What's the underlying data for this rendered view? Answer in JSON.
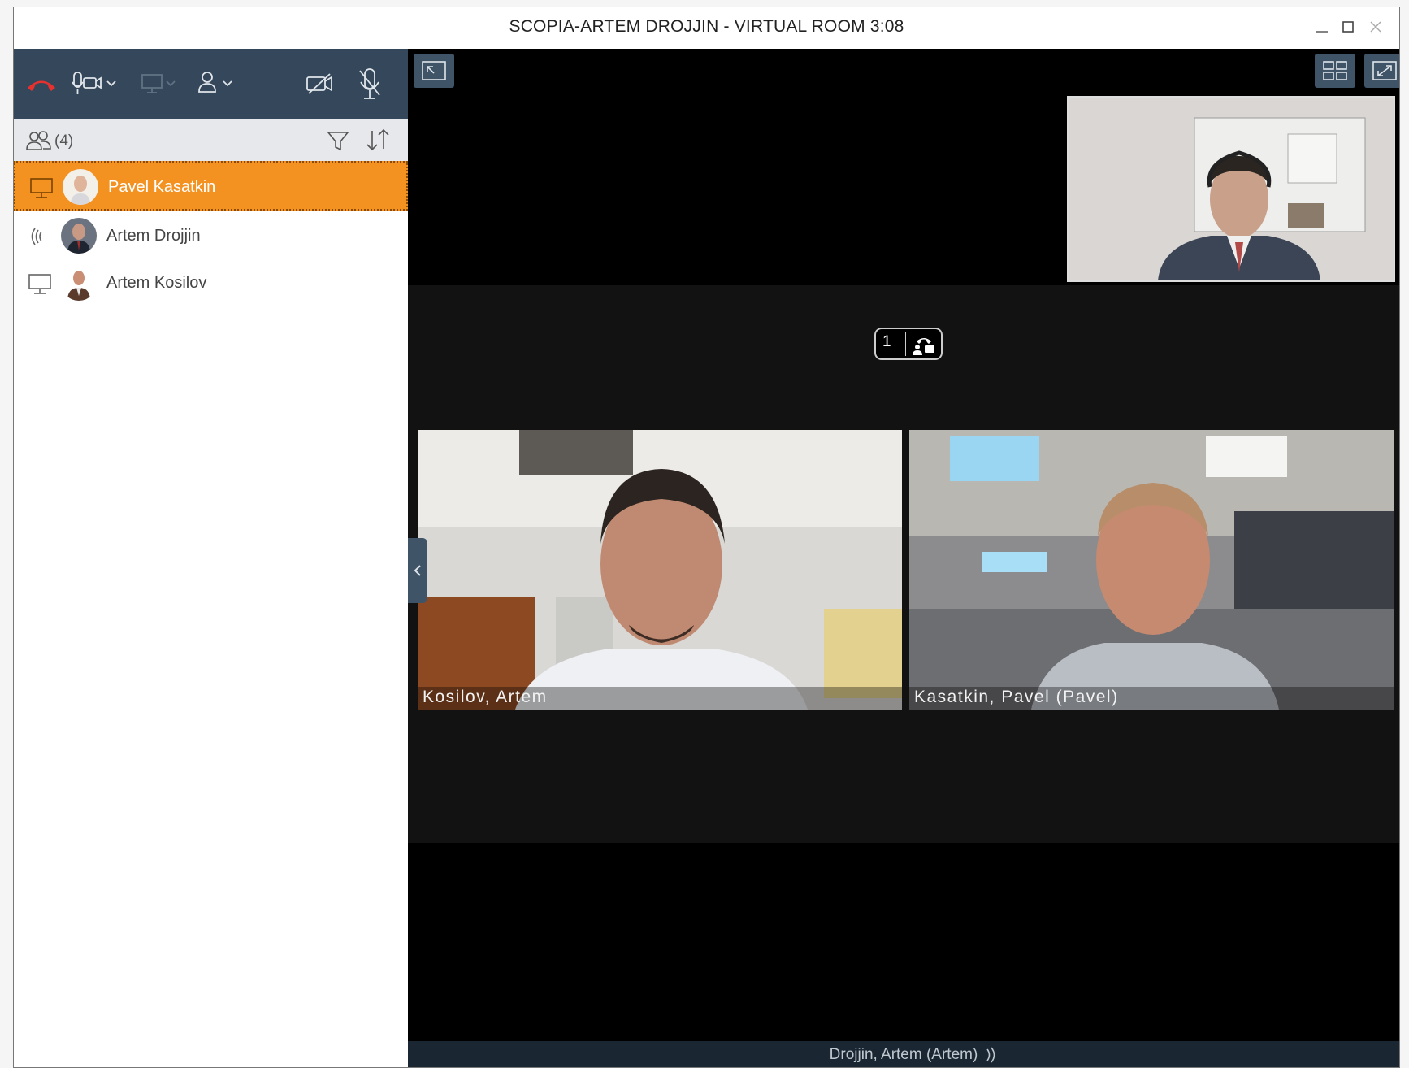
{
  "window": {
    "title": "SCOPIA-ARTEM DROJJIN - VIRTUAL ROOM 3:08",
    "controls": [
      "minimize-icon",
      "maximize-icon",
      "close-icon"
    ]
  },
  "toolbar": {
    "icons": [
      "hangup-icon",
      "microphone-camera-icon",
      "chevron-down-icon",
      "share-screen-icon",
      "participant-icon",
      "camera-off-icon",
      "microphone-off-icon"
    ],
    "colors": {
      "background": "#35475a",
      "hangup": "#e8312f"
    }
  },
  "participants": {
    "count": "(4)",
    "items": [
      {
        "name": "Pavel Kasatkin",
        "lead_icon": "presentation-icon",
        "selected": true
      },
      {
        "name": "Artem Drojjin",
        "lead_icon": "speaking-icon",
        "selected": false
      },
      {
        "name": "Artem Kosilov",
        "lead_icon": "presentation-icon",
        "selected": false
      }
    ],
    "colors": {
      "selected": "#f39221"
    }
  },
  "video": {
    "layout_badge": "1",
    "tiles": [
      {
        "label": "Kosilov, Artem"
      },
      {
        "label": "Kasatkin, Pavel (Pavel)"
      }
    ]
  },
  "status": {
    "speaker": "Drojjin, Artem (Artem)"
  }
}
